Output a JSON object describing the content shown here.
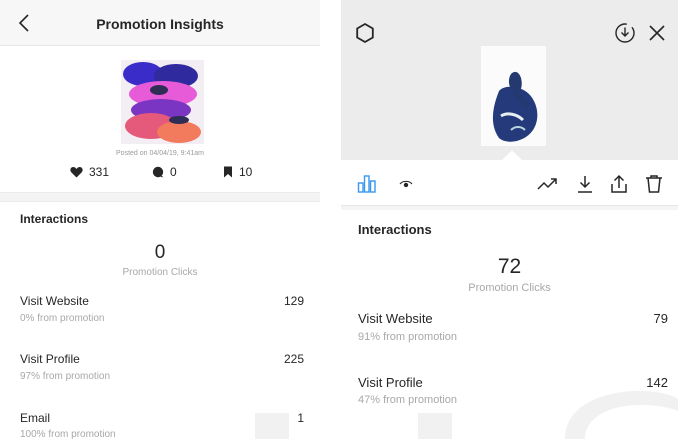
{
  "left": {
    "header": {
      "title": "Promotion Insights"
    },
    "post": {
      "posted_on": "Posted on 04/04/19, 9:41am"
    },
    "stats": {
      "likes": "331",
      "comments": "0",
      "saves": "10"
    },
    "interactions": {
      "title": "Interactions",
      "clicks_value": "0",
      "clicks_label": "Promotion Clicks",
      "rows": [
        {
          "label": "Visit Website",
          "sub": "0% from promotion",
          "value": "129"
        },
        {
          "label": "Visit Profile",
          "sub": "97% from promotion",
          "value": "225"
        },
        {
          "label": "Email",
          "sub": "100% from promotion",
          "value": "1"
        }
      ]
    }
  },
  "right": {
    "interactions": {
      "title": "Interactions",
      "clicks_value": "72",
      "clicks_label": "Promotion Clicks",
      "rows": [
        {
          "label": "Visit Website",
          "sub": "91% from promotion",
          "value": "79"
        },
        {
          "label": "Visit Profile",
          "sub": "47% from promotion",
          "value": "142"
        }
      ]
    }
  },
  "icons": {
    "back": "chevron-left-icon",
    "like": "heart-icon",
    "comment": "comment-icon",
    "save": "bookmark-icon",
    "settings": "gear-icon",
    "download_circle": "download-circle-icon",
    "close": "close-icon",
    "insights": "bar-chart-icon",
    "views": "eye-icon",
    "trend": "trend-icon",
    "download": "download-icon",
    "share": "share-icon",
    "delete": "trash-icon"
  },
  "colors": {
    "accent": "#3897f0",
    "text": "#262626",
    "muted": "#a8a8a8",
    "header_bg": "#f7f7f7",
    "preview_bg": "#ececec"
  }
}
